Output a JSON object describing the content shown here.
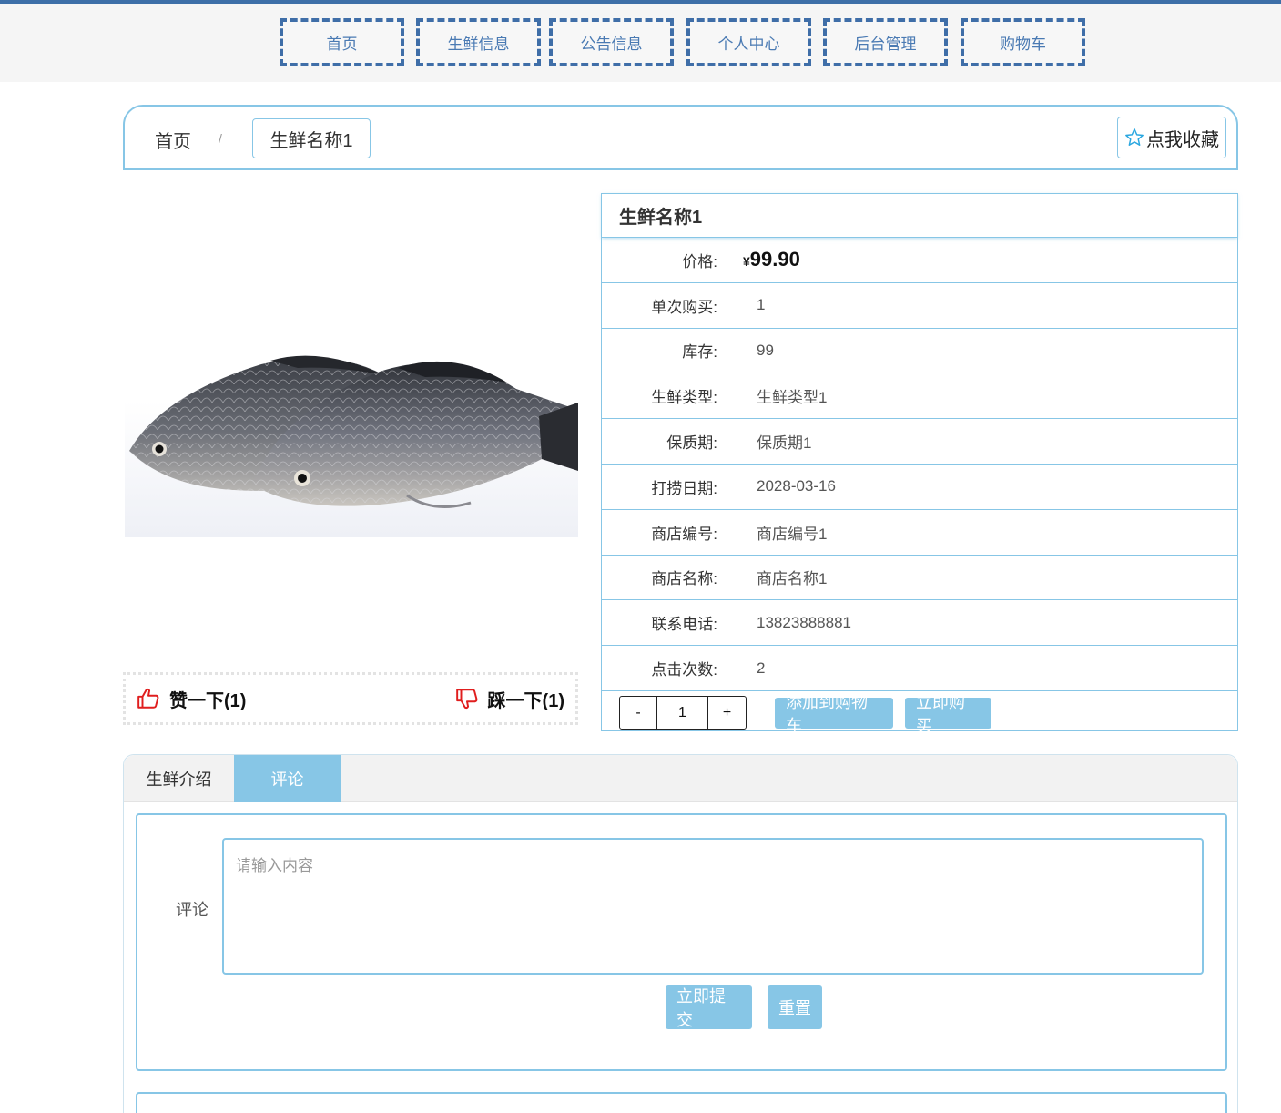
{
  "nav": [
    "首页",
    "生鲜信息",
    "公告信息",
    "个人中心",
    "后台管理",
    "购物车"
  ],
  "breadcrumb": {
    "home": "首页",
    "separator": "/",
    "current": "生鲜名称1"
  },
  "favorite_label": "点我收藏",
  "votes": {
    "like": "赞一下(1)",
    "dislike": "踩一下(1)"
  },
  "product": {
    "name": "生鲜名称1",
    "price_label": "价格:",
    "currency": "¥",
    "price": "99.90",
    "rows": [
      {
        "label": "单次购买:",
        "value": "1"
      },
      {
        "label": "库存:",
        "value": "99"
      },
      {
        "label": "生鲜类型:",
        "value": "生鲜类型1"
      },
      {
        "label": "保质期:",
        "value": "保质期1"
      },
      {
        "label": "打捞日期:",
        "value": "2028-03-16"
      },
      {
        "label": "商店编号:",
        "value": "商店编号1"
      },
      {
        "label": "商店名称:",
        "value": "商店名称1"
      },
      {
        "label": "联系电话:",
        "value": "13823888881"
      },
      {
        "label": "点击次数:",
        "value": "2"
      }
    ]
  },
  "stepper": {
    "minus": "-",
    "quantity": "1",
    "plus": "+"
  },
  "actions": {
    "add_to_cart": "添加到购物车",
    "buy_now": "立即购买"
  },
  "tabs": [
    {
      "label": "生鲜介绍",
      "active": false
    },
    {
      "label": "评论",
      "active": true
    }
  ],
  "comment": {
    "label": "评论",
    "placeholder": "请输入内容",
    "submit": "立即提交",
    "reset": "重置"
  },
  "colors": {
    "accent": "#87c6e6",
    "nav_border": "#3f6ea8",
    "vote_icon": "#e01e1e"
  }
}
